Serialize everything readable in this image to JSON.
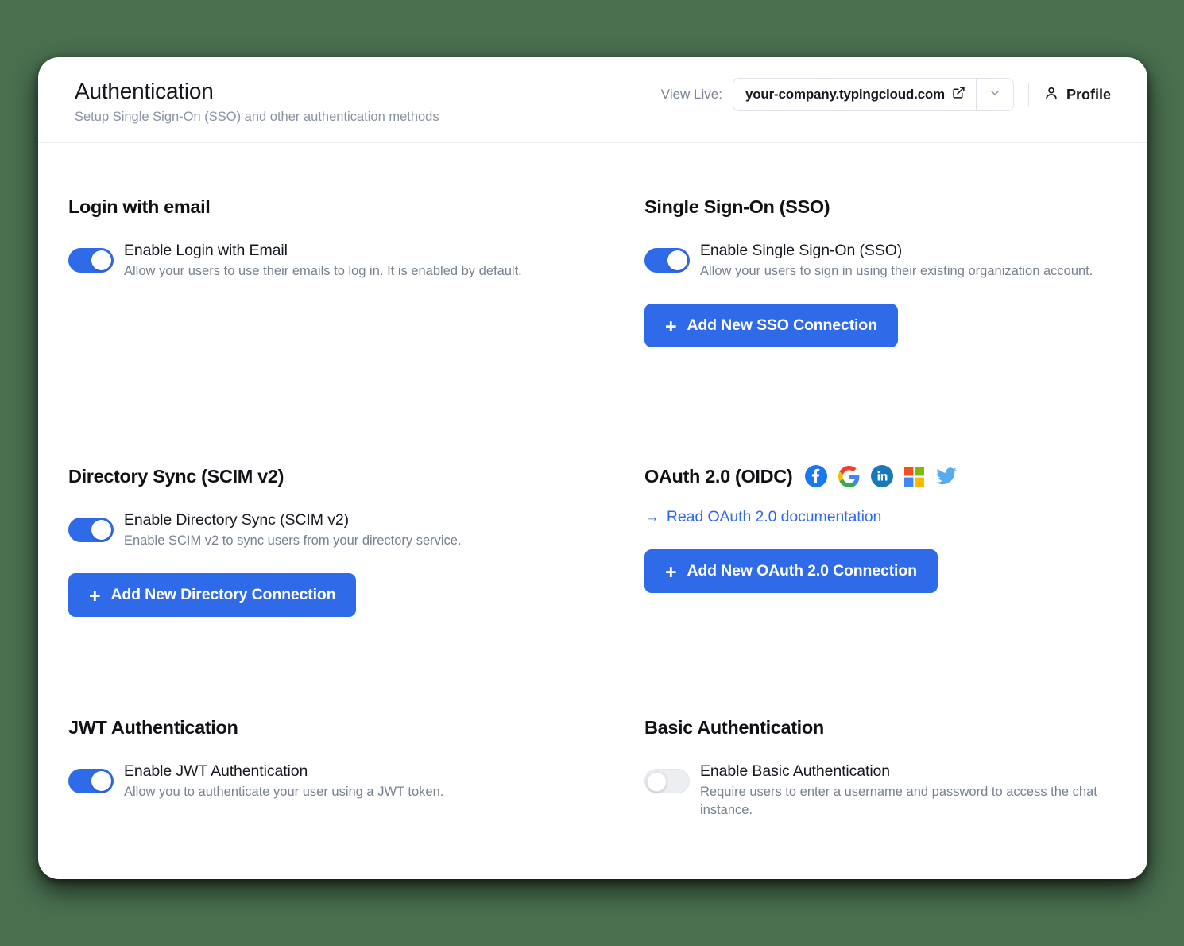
{
  "header": {
    "title": "Authentication",
    "subtitle": "Setup Single Sign-On (SSO) and other authentication methods",
    "view_live_label": "View Live:",
    "live_url": "your-company.typingcloud.com",
    "external_link_icon": "external-link-icon",
    "caret_icon": "chevron-down-icon",
    "profile_label": "Profile",
    "profile_icon": "person-icon"
  },
  "sections": {
    "login_email": {
      "title": "Login with email",
      "toggle_label": "Enable Login with Email",
      "toggle_desc": "Allow your users to use their emails to log in. It is enabled by default.",
      "toggle_state": "on"
    },
    "sso": {
      "title": "Single Sign-On (SSO)",
      "toggle_label": "Enable Single Sign-On (SSO)",
      "toggle_desc": "Allow your users to sign in using their existing organization account.",
      "toggle_state": "on",
      "button_label": "Add New SSO Connection",
      "button_icon": "plus-icon"
    },
    "directory_sync": {
      "title": "Directory Sync (SCIM v2)",
      "toggle_label": "Enable Directory Sync (SCIM v2)",
      "toggle_desc": "Enable SCIM v2 to sync users from your directory service.",
      "toggle_state": "on",
      "button_label": "Add New Directory Connection",
      "button_icon": "plus-icon"
    },
    "oauth": {
      "title": "OAuth 2.0 (OIDC)",
      "provider_icons": [
        "facebook-icon",
        "google-icon",
        "linkedin-icon",
        "microsoft-icon",
        "twitter-icon"
      ],
      "doc_link_label": "Read OAuth 2.0 documentation",
      "doc_link_icon": "arrow-right-icon",
      "button_label": "Add New OAuth 2.0 Connection",
      "button_icon": "plus-icon"
    },
    "jwt": {
      "title": "JWT Authentication",
      "toggle_label": "Enable JWT Authentication",
      "toggle_desc": "Allow you to authenticate your user using a JWT token.",
      "toggle_state": "on"
    },
    "basic": {
      "title": "Basic Authentication",
      "toggle_label": "Enable Basic Authentication",
      "toggle_desc": "Require users to enter a username and password to access the chat instance.",
      "toggle_state": "off"
    }
  },
  "colors": {
    "accent": "#2f6ae8",
    "page_background": "#4a7050",
    "card_background": "#ffffff",
    "muted_text": "#78818f",
    "toggle_off": "#eceef1"
  }
}
